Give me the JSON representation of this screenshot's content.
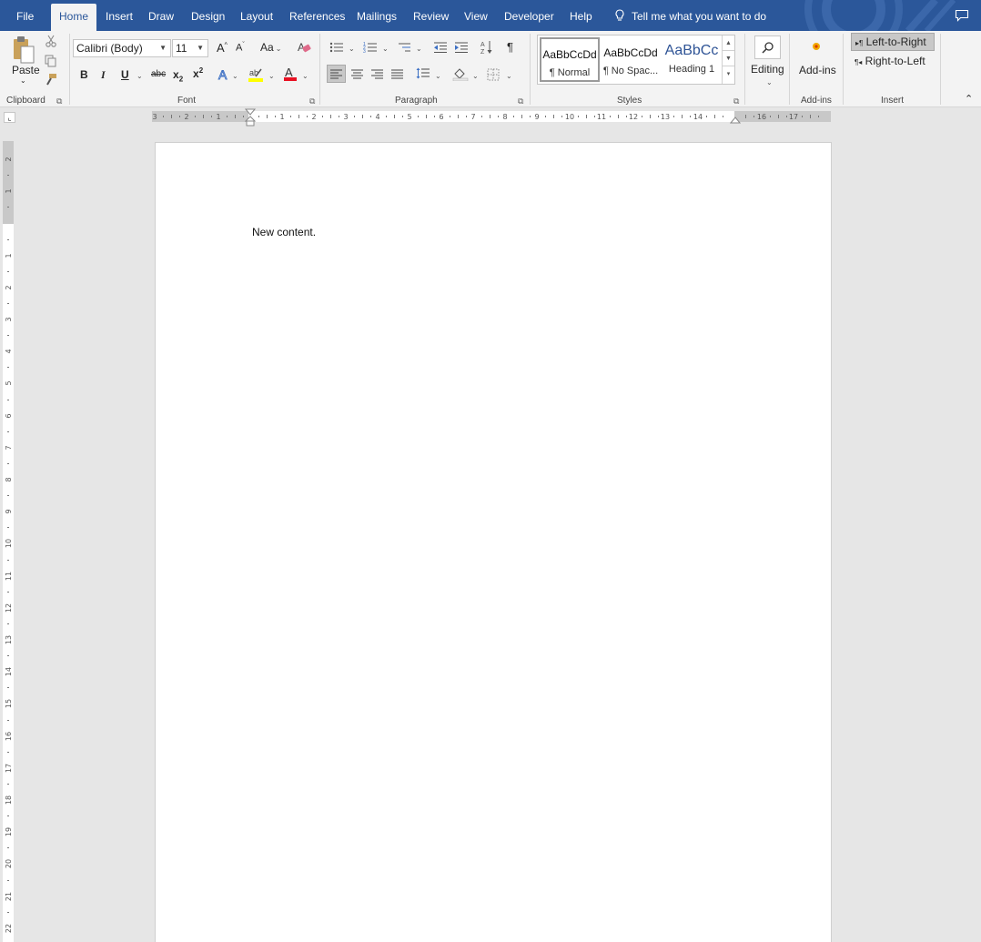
{
  "tabs": [
    "File",
    "Home",
    "Insert",
    "Draw",
    "Design",
    "Layout",
    "References",
    "Mailings",
    "Review",
    "View",
    "Developer",
    "Help"
  ],
  "active_tab": "Home",
  "tell_me": "Tell me what you want to do",
  "clipboard": {
    "paste_label": "Paste",
    "group_label": "Clipboard"
  },
  "font": {
    "name": "Calibri (Body)",
    "size": "11",
    "case_label": "Aa",
    "group_label": "Font",
    "bold": "B",
    "italic": "I",
    "underline": "U",
    "strike": "abc",
    "grow": "A",
    "shrink": "A"
  },
  "paragraph": {
    "group_label": "Paragraph",
    "pilcrow": "¶"
  },
  "styles": {
    "items": [
      {
        "preview": "AaBbCcDd",
        "name": "¶ Normal"
      },
      {
        "preview": "AaBbCcDd",
        "name": "¶ No Spac..."
      },
      {
        "preview": "AaBbCc",
        "name": "Heading 1"
      }
    ],
    "group_label": "Styles"
  },
  "editing": {
    "label": "Editing"
  },
  "addins": {
    "label": "Add-ins",
    "group_label": "Add-ins"
  },
  "insert": {
    "ltr": "Left-to-Right",
    "rtl": "Right-to-Left",
    "group_label": "Insert"
  },
  "document": {
    "text": "New content."
  },
  "colors": {
    "brand": "#2b579a",
    "highlight": "#ffff00",
    "font_color": "#e81123"
  }
}
